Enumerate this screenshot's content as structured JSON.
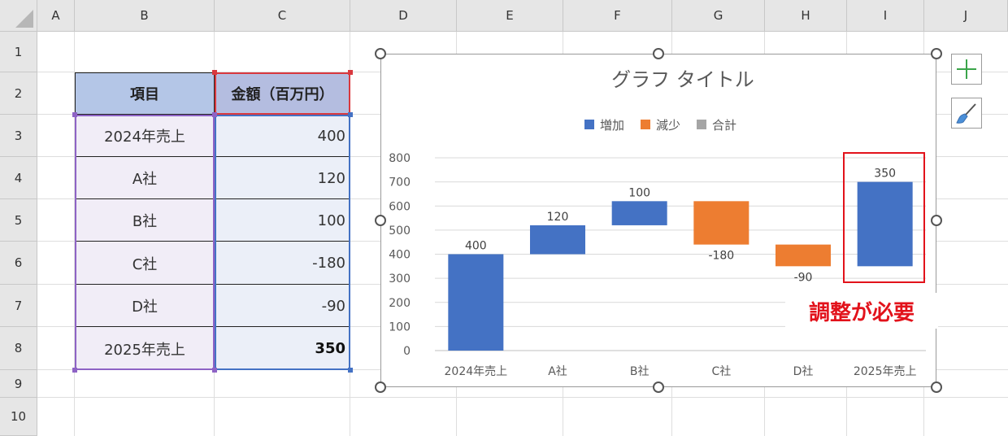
{
  "spreadsheet": {
    "columns": [
      "A",
      "B",
      "C",
      "D",
      "E",
      "F",
      "G",
      "H",
      "I",
      "J"
    ],
    "rows": [
      "1",
      "2",
      "3",
      "4",
      "5",
      "6",
      "7",
      "8",
      "9",
      "10"
    ],
    "table": {
      "headers": [
        "項目",
        "金額（百万円）"
      ],
      "rows": [
        {
          "item": "2024年売上",
          "amount": "400"
        },
        {
          "item": "A社",
          "amount": "120"
        },
        {
          "item": "B社",
          "amount": "100"
        },
        {
          "item": "C社",
          "amount": "-180"
        },
        {
          "item": "D社",
          "amount": "-90"
        },
        {
          "item": "2025年売上",
          "amount": "350"
        }
      ]
    }
  },
  "annotation": "調整が必要",
  "icons": [
    "plus-icon",
    "paintbrush-icon"
  ],
  "chart_data": {
    "type": "bar",
    "subtype": "waterfall",
    "title": "グラフ タイトル",
    "categories": [
      "2024年売上",
      "A社",
      "B社",
      "C社",
      "D社",
      "2025年売上"
    ],
    "values": [
      400,
      120,
      100,
      -180,
      -90,
      350
    ],
    "data_labels": [
      "400",
      "120",
      "100",
      "-180",
      "-90",
      "350"
    ],
    "legend": [
      {
        "name": "増加",
        "color": "#4472c4"
      },
      {
        "name": "減少",
        "color": "#ed7d31"
      },
      {
        "name": "合計",
        "color": "#a5a5a5"
      }
    ],
    "legend_position": "top",
    "ylim": [
      0,
      800
    ],
    "yticks": [
      "0",
      "100",
      "200",
      "300",
      "400",
      "500",
      "600",
      "700",
      "800"
    ],
    "grid": true,
    "colors": {
      "increase": "#4472c4",
      "decrease": "#ed7d31",
      "highlight": "#e2121b"
    }
  }
}
